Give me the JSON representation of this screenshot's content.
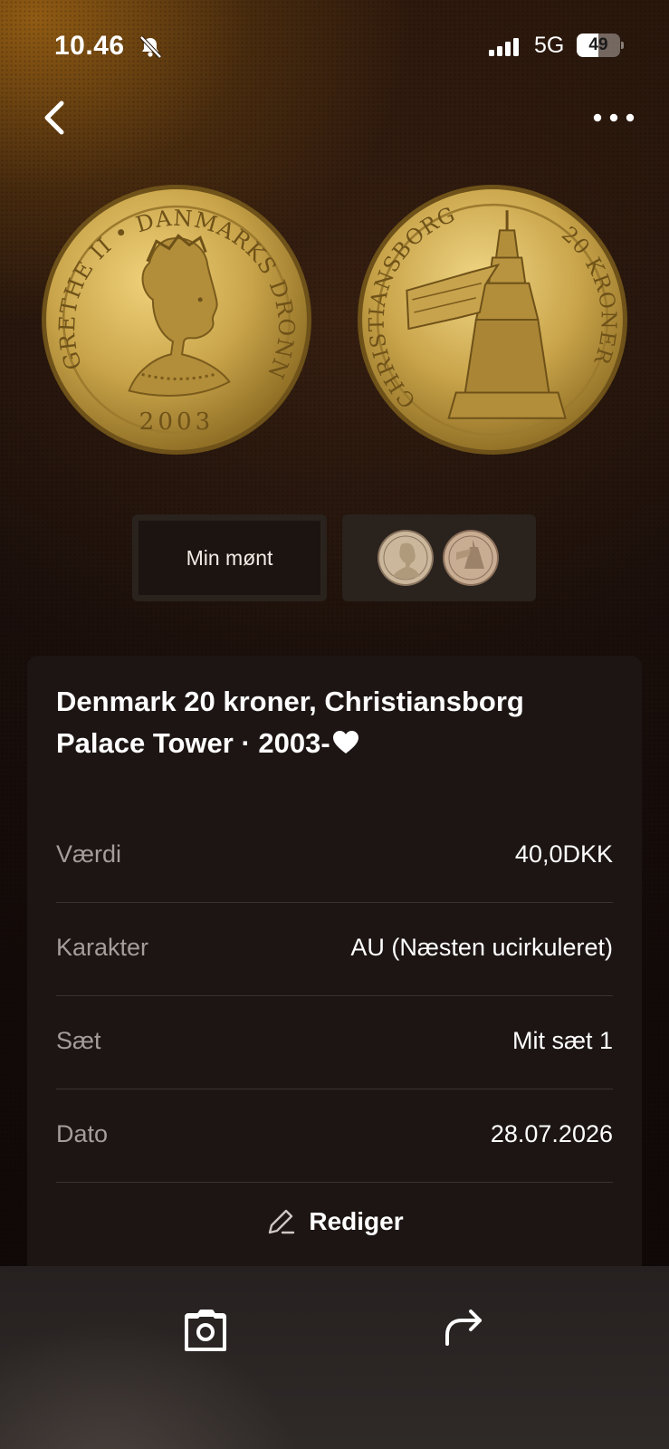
{
  "status_bar": {
    "time": "10.46",
    "network": "5G",
    "battery": "49",
    "battery_level": 0.49,
    "icons": [
      "bell-muted-icon",
      "signal-icon",
      "battery-icon"
    ]
  },
  "nav": {
    "back_icon": "chevron-left-icon",
    "more_icon": "ellipsis-icon"
  },
  "coin": {
    "obverse_legend": "MARGRETHE II • DANMARKS DRONNING",
    "obverse_year": "2003",
    "reverse_legend_left": "CHRISTIANSBORG",
    "reverse_legend_right": "20 KRONER",
    "metal_color": "#c9a44a"
  },
  "tabs": {
    "mine_label": "Min mønt"
  },
  "details": {
    "title": "Denmark 20 kroner, Christiansborg Palace Tower · 2003-",
    "heart_icon": "heart-icon",
    "rows": [
      {
        "key": "Værdi",
        "value": "40,0DKK"
      },
      {
        "key": "Karakter",
        "value": "AU (Næsten ucirkuleret)"
      },
      {
        "key": "Sæt",
        "value": "Mit sæt 1"
      },
      {
        "key": "Dato",
        "value": "28.07.2026"
      }
    ],
    "edit_label": "Rediger",
    "edit_icon": "pencil-icon"
  },
  "bottom_bar": {
    "photo_icon": "photo-icon",
    "share_icon": "share-arrow-icon"
  }
}
